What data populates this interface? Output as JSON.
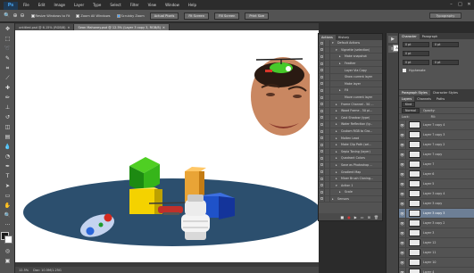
{
  "app": {
    "logo": "Ps"
  },
  "menu": [
    "File",
    "Edit",
    "Image",
    "Layer",
    "Type",
    "Select",
    "Filter",
    "View",
    "Window",
    "Help"
  ],
  "window_controls": [
    "–",
    "□",
    "✕"
  ],
  "options_bar": {
    "checkbox_scroll_all": "Resize Windows to Fit",
    "checkbox_zoom_all": "Zoom All Windows",
    "checkbox_scrubby": "Scrubby Zoom",
    "buttons": [
      "Actual Pixels",
      "Fit Screen",
      "Fill Screen",
      "Print Size"
    ],
    "workspace": "Typography"
  },
  "doc_tabs": [
    {
      "label": "untitled.psd @ 6.15% (RGB/8)",
      "active": false
    },
    {
      "label": "Sean Mahoney.psd @ 12.5% (Layer 3 copy 3, RGB/8)",
      "active": true
    }
  ],
  "status": {
    "zoom": "12.5%",
    "doc": "Doc: 10.5M/1.25G"
  },
  "actions_panel": {
    "tabs": [
      "Actions",
      "History"
    ],
    "tooltip": "Actions",
    "rows": [
      {
        "expand": "▾",
        "label": "Default Actions",
        "indent": 0
      },
      {
        "expand": "▾",
        "label": "Vignette (selection)",
        "indent": 1
      },
      {
        "expand": "▸",
        "label": "Make snapshot",
        "indent": 2
      },
      {
        "expand": "▸",
        "label": "Feather",
        "indent": 2
      },
      {
        "expand": "",
        "label": "Layer Via Copy",
        "indent": 2
      },
      {
        "expand": "",
        "label": "Show current layer",
        "indent": 2
      },
      {
        "expand": "",
        "label": "Make layer",
        "indent": 2
      },
      {
        "expand": "▸",
        "label": "Fill",
        "indent": 2
      },
      {
        "expand": "",
        "label": "Move current layer",
        "indent": 2
      },
      {
        "expand": "▸",
        "label": "Frame Channel - 50 ...",
        "indent": 1
      },
      {
        "expand": "▸",
        "label": "Wood Frame - 50 pi...",
        "indent": 1
      },
      {
        "expand": "▸",
        "label": "Cast Shadow (type)",
        "indent": 1
      },
      {
        "expand": "▸",
        "label": "Water Reflection (ty...",
        "indent": 1
      },
      {
        "expand": "▸",
        "label": "Custom RGB to Gra...",
        "indent": 1
      },
      {
        "expand": "▸",
        "label": "Molten Lead",
        "indent": 1
      },
      {
        "expand": "▸",
        "label": "Make Clip Path (sel...",
        "indent": 1
      },
      {
        "expand": "▸",
        "label": "Sepia Toning (layer)",
        "indent": 1
      },
      {
        "expand": "▸",
        "label": "Quadrant Colors",
        "indent": 1
      },
      {
        "expand": "▸",
        "label": "Save as Photoshop ...",
        "indent": 1
      },
      {
        "expand": "▸",
        "label": "Gradient Map",
        "indent": 1
      },
      {
        "expand": "▸",
        "label": "Mixer Brush Cloning...",
        "indent": 1
      },
      {
        "expand": "▾",
        "label": "Action 1",
        "indent": 1
      },
      {
        "expand": "▸",
        "label": "Scale",
        "indent": 2
      },
      {
        "expand": "▸",
        "label": "Sensors",
        "indent": 0
      }
    ],
    "footer": [
      "■",
      "●",
      "▶",
      "▭",
      "⊞",
      "🗑"
    ]
  },
  "right_panel": {
    "char_tabs": [
      "Character",
      "Paragraph"
    ],
    "char_fields": [
      "0 pt",
      "0 pt",
      "0 pt",
      "0 pt",
      "0 pt",
      "0 pt"
    ],
    "hyphenate": "Hyphenate",
    "para_tabs": [
      "Paragraph Styles",
      "Character Styles"
    ],
    "layers_tabs": [
      "Layers",
      "Channels",
      "Paths"
    ],
    "kind": "Kind",
    "blend": "Normal",
    "opacity": "Opacity:",
    "lock": "Lock:",
    "fill": "Fill:",
    "layers": [
      {
        "name": "Layer 7 copy 4",
        "selected": false
      },
      {
        "name": "Layer 7 copy 3",
        "selected": false
      },
      {
        "name": "Layer 7 copy 2",
        "selected": false
      },
      {
        "name": "Layer 7 copy",
        "selected": false
      },
      {
        "name": "Layer 7",
        "selected": false
      },
      {
        "name": "Layer 6",
        "selected": false
      },
      {
        "name": "Layer 5",
        "selected": false
      },
      {
        "name": "Layer 3 copy 4",
        "selected": false
      },
      {
        "name": "Layer 3 copy",
        "selected": false
      },
      {
        "name": "Layer 3 copy 3",
        "selected": true
      },
      {
        "name": "Layer 3 copy 2",
        "selected": false
      },
      {
        "name": "Layer 3",
        "selected": false
      },
      {
        "name": "Layer 12",
        "selected": false
      },
      {
        "name": "Layer 11",
        "selected": false
      },
      {
        "name": "Layer 10",
        "selected": false
      },
      {
        "name": "Layer 4",
        "selected": false
      }
    ]
  }
}
